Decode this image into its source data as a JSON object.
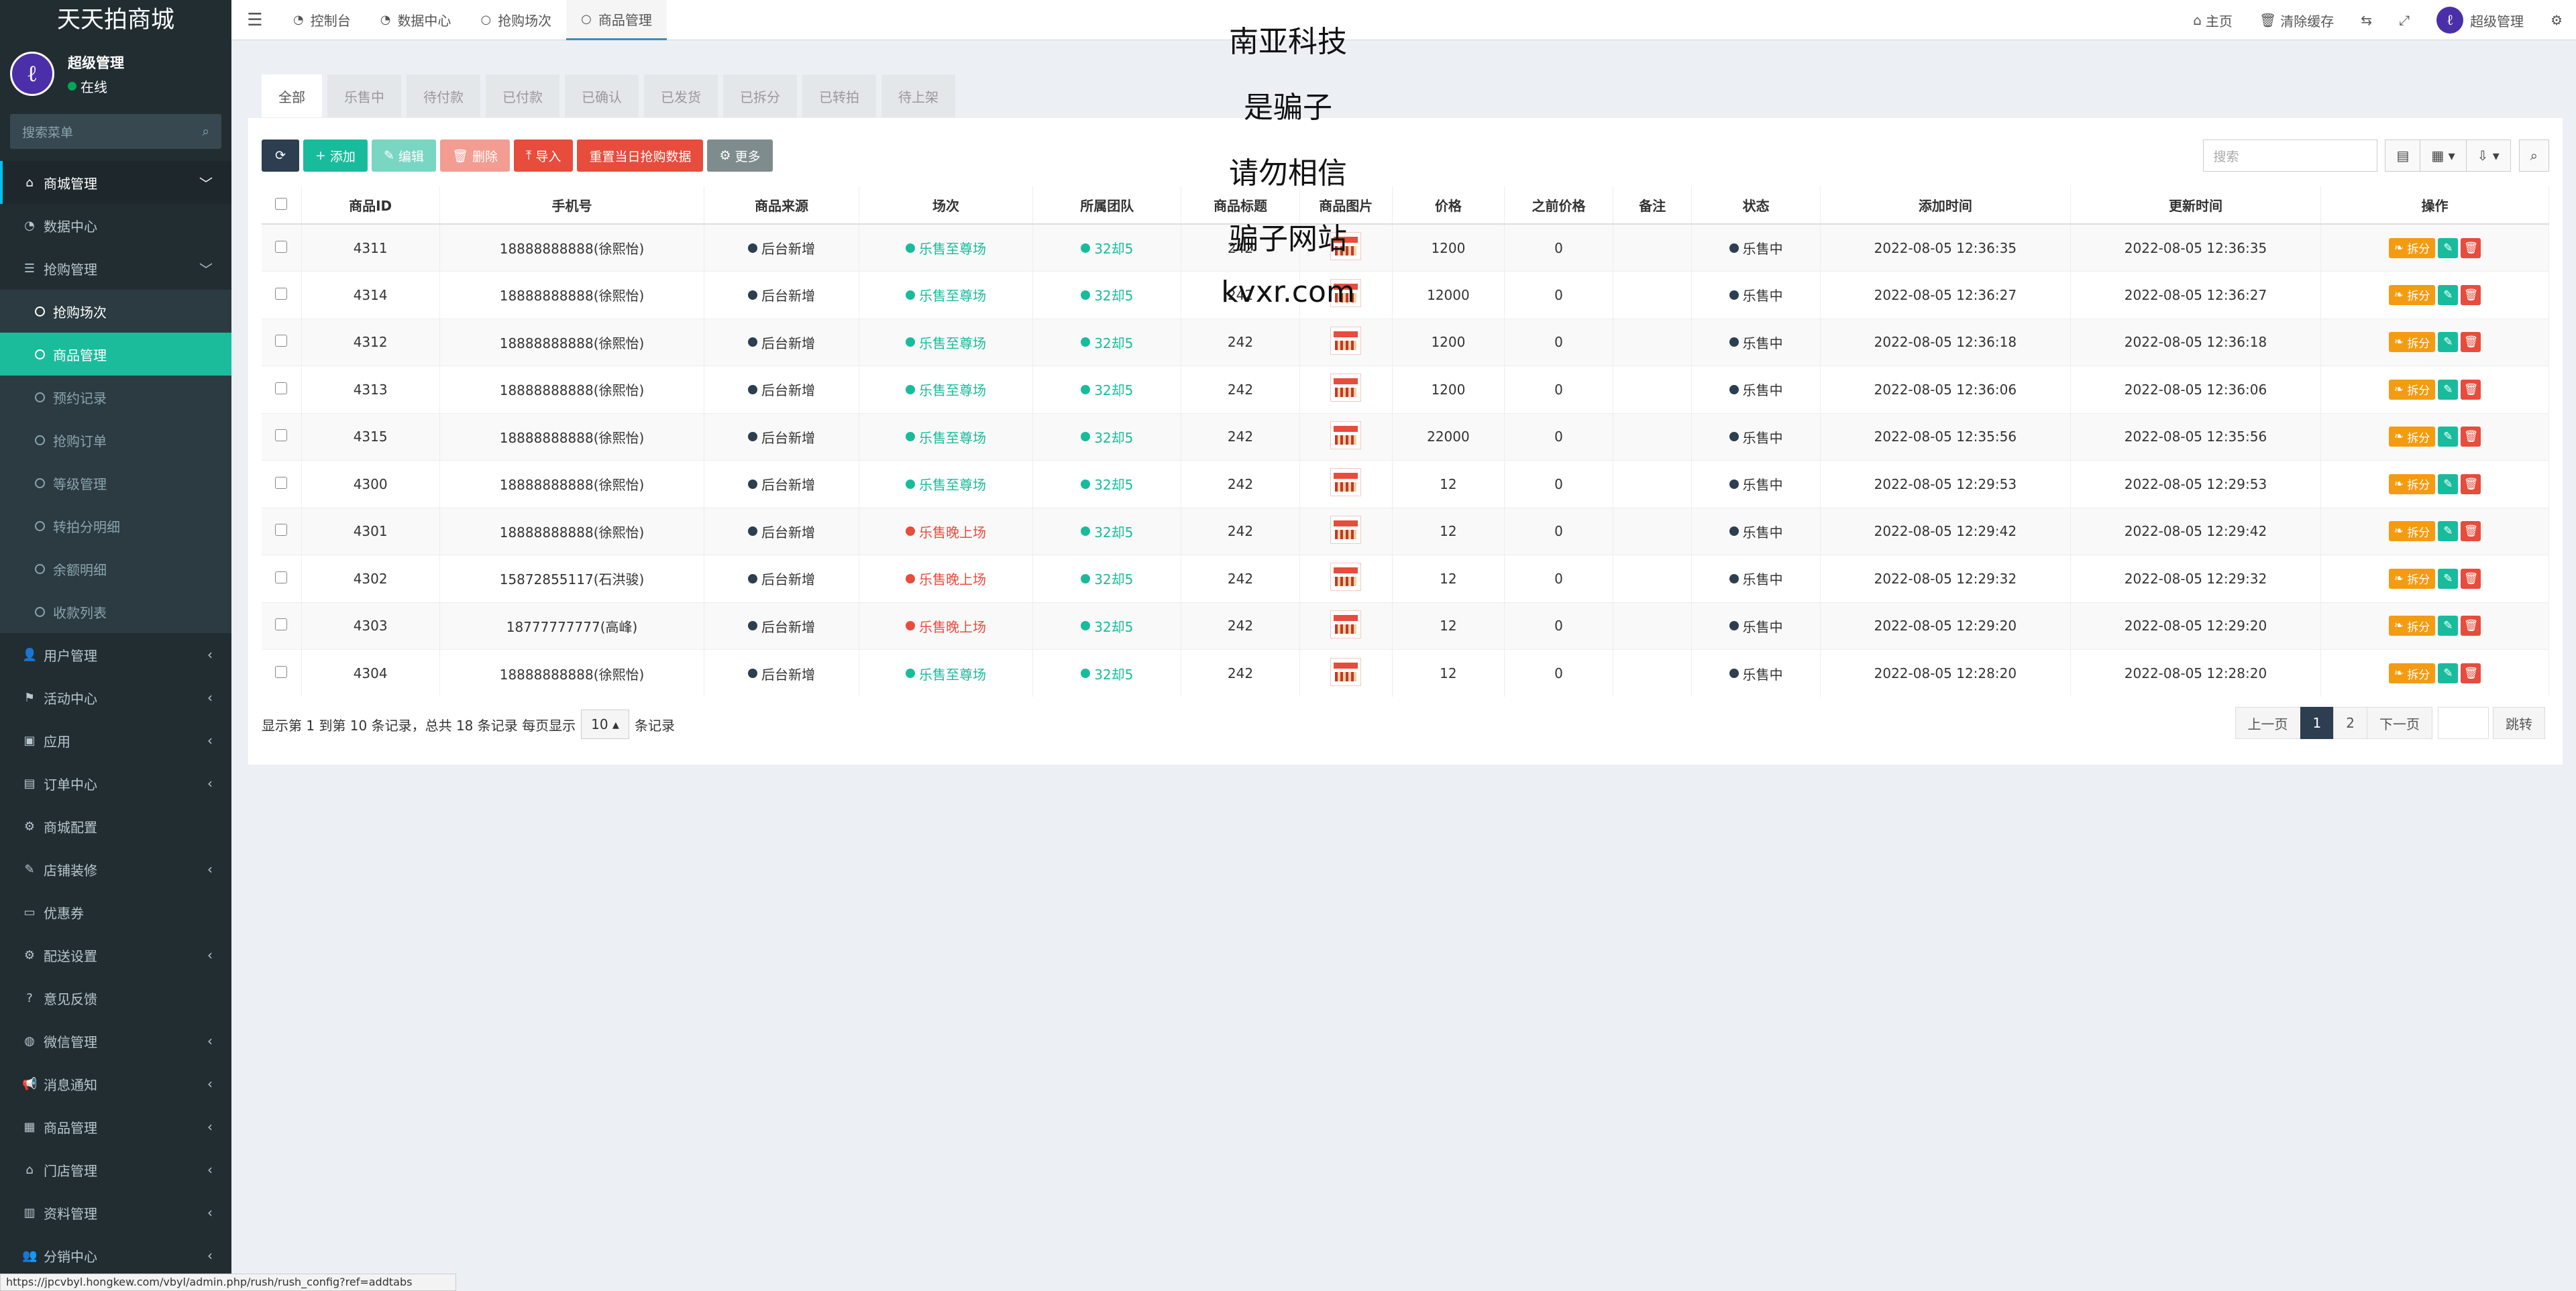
{
  "app": {
    "title": "天天拍商城"
  },
  "user": {
    "name": "超级管理",
    "status": "在线"
  },
  "sidebar": {
    "search_placeholder": "搜索菜单",
    "items": [
      {
        "label": "商城管理",
        "icon": "home-icon",
        "arrow": "﹀",
        "active": true
      },
      {
        "label": "数据中心",
        "icon": "dashboard-icon"
      },
      {
        "label": "抢购管理",
        "icon": "list-icon",
        "arrow": "﹀"
      }
    ],
    "submenu": [
      {
        "label": "抢购场次",
        "hot": true
      },
      {
        "label": "商品管理",
        "current": true
      },
      {
        "label": "预约记录"
      },
      {
        "label": "抢购订单"
      },
      {
        "label": "等级管理"
      },
      {
        "label": "转拍分明细"
      },
      {
        "label": "余额明细"
      },
      {
        "label": "收款列表"
      }
    ],
    "items_after": [
      {
        "label": "用户管理",
        "icon": "user-icon",
        "arrow": "‹"
      },
      {
        "label": "活动中心",
        "icon": "flag-icon",
        "arrow": "‹"
      },
      {
        "label": "应用",
        "icon": "app-icon",
        "arrow": "‹"
      },
      {
        "label": "订单中心",
        "icon": "file-icon",
        "arrow": "‹"
      },
      {
        "label": "商城配置",
        "icon": "gear-icon"
      },
      {
        "label": "店铺装修",
        "icon": "brush-icon",
        "arrow": "‹"
      },
      {
        "label": "优惠券",
        "icon": "ticket-icon"
      },
      {
        "label": "配送设置",
        "icon": "cogs-icon",
        "arrow": "‹"
      },
      {
        "label": "意见反馈",
        "icon": "question-icon"
      },
      {
        "label": "微信管理",
        "icon": "wechat-icon",
        "arrow": "‹"
      },
      {
        "label": "消息通知",
        "icon": "bullhorn-icon",
        "arrow": "‹"
      },
      {
        "label": "商品管理",
        "icon": "box-icon",
        "arrow": "‹"
      },
      {
        "label": "门店管理",
        "icon": "bank-icon",
        "arrow": "‹"
      },
      {
        "label": "资料管理",
        "icon": "book-icon",
        "arrow": "‹"
      },
      {
        "label": "分销中心",
        "icon": "users-icon",
        "arrow": "‹"
      }
    ]
  },
  "topbar": {
    "tabs": [
      {
        "label": "控制台",
        "icon": "dashboard-icon"
      },
      {
        "label": "数据中心",
        "icon": "dashboard-icon"
      },
      {
        "label": "抢购场次",
        "icon": "circle-icon"
      },
      {
        "label": "商品管理",
        "icon": "circle-icon",
        "active": true
      }
    ],
    "right": {
      "home": "主页",
      "clear_cache": "清除缓存",
      "admin": "超级管理"
    }
  },
  "watermark": [
    "南亚科技",
    "是骗子",
    "请勿相信",
    "骗子网站",
    "kvxr.com"
  ],
  "status_tabs": [
    "全部",
    "乐售中",
    "待付款",
    "已付款",
    "已确认",
    "已发货",
    "已拆分",
    "已转拍",
    "待上架"
  ],
  "toolbar": {
    "add": "添加",
    "edit": "编辑",
    "delete": "删除",
    "import": "导入",
    "reset": "重置当日抢购数据",
    "more": "更多",
    "search_placeholder": "搜索"
  },
  "table": {
    "headers": [
      "商品ID",
      "手机号",
      "商品来源",
      "场次",
      "所属团队",
      "商品标题",
      "商品图片",
      "价格",
      "之前价格",
      "备注",
      "状态",
      "添加时间",
      "更新时间",
      "操作"
    ],
    "rows": [
      {
        "id": "4311",
        "phone": "18888888888(徐熙怡)",
        "source": "后台新增",
        "session": "乐售至尊场",
        "session_color": "green",
        "team": "32却5",
        "title": "242",
        "price": "1200",
        "prev": "0",
        "note": "",
        "status": "乐售中",
        "added": "2022-08-05 12:36:35",
        "updated": "2022-08-05 12:36:35"
      },
      {
        "id": "4314",
        "phone": "18888888888(徐熙怡)",
        "source": "后台新增",
        "session": "乐售至尊场",
        "session_color": "green",
        "team": "32却5",
        "title": "242",
        "price": "12000",
        "prev": "0",
        "note": "",
        "status": "乐售中",
        "added": "2022-08-05 12:36:27",
        "updated": "2022-08-05 12:36:27"
      },
      {
        "id": "4312",
        "phone": "18888888888(徐熙怡)",
        "source": "后台新增",
        "session": "乐售至尊场",
        "session_color": "green",
        "team": "32却5",
        "title": "242",
        "price": "1200",
        "prev": "0",
        "note": "",
        "status": "乐售中",
        "added": "2022-08-05 12:36:18",
        "updated": "2022-08-05 12:36:18"
      },
      {
        "id": "4313",
        "phone": "18888888888(徐熙怡)",
        "source": "后台新增",
        "session": "乐售至尊场",
        "session_color": "green",
        "team": "32却5",
        "title": "242",
        "price": "1200",
        "prev": "0",
        "note": "",
        "status": "乐售中",
        "added": "2022-08-05 12:36:06",
        "updated": "2022-08-05 12:36:06"
      },
      {
        "id": "4315",
        "phone": "18888888888(徐熙怡)",
        "source": "后台新增",
        "session": "乐售至尊场",
        "session_color": "green",
        "team": "32却5",
        "title": "242",
        "price": "22000",
        "prev": "0",
        "note": "",
        "status": "乐售中",
        "added": "2022-08-05 12:35:56",
        "updated": "2022-08-05 12:35:56"
      },
      {
        "id": "4300",
        "phone": "18888888888(徐熙怡)",
        "source": "后台新增",
        "session": "乐售至尊场",
        "session_color": "green",
        "team": "32却5",
        "title": "242",
        "price": "12",
        "prev": "0",
        "note": "",
        "status": "乐售中",
        "added": "2022-08-05 12:29:53",
        "updated": "2022-08-05 12:29:53"
      },
      {
        "id": "4301",
        "phone": "18888888888(徐熙怡)",
        "source": "后台新增",
        "session": "乐售晚上场",
        "session_color": "red",
        "team": "32却5",
        "title": "242",
        "price": "12",
        "prev": "0",
        "note": "",
        "status": "乐售中",
        "added": "2022-08-05 12:29:42",
        "updated": "2022-08-05 12:29:42"
      },
      {
        "id": "4302",
        "phone": "15872855117(石洪骏)",
        "source": "后台新增",
        "session": "乐售晚上场",
        "session_color": "red",
        "team": "32却5",
        "title": "242",
        "price": "12",
        "prev": "0",
        "note": "",
        "status": "乐售中",
        "added": "2022-08-05 12:29:32",
        "updated": "2022-08-05 12:29:32"
      },
      {
        "id": "4303",
        "phone": "18777777777(高峰)",
        "source": "后台新增",
        "session": "乐售晚上场",
        "session_color": "red",
        "team": "32却5",
        "title": "242",
        "price": "12",
        "prev": "0",
        "note": "",
        "status": "乐售中",
        "added": "2022-08-05 12:29:20",
        "updated": "2022-08-05 12:29:20"
      },
      {
        "id": "4304",
        "phone": "18888888888(徐熙怡)",
        "source": "后台新增",
        "session": "乐售至尊场",
        "session_color": "green",
        "team": "32却5",
        "title": "242",
        "price": "12",
        "prev": "0",
        "note": "",
        "status": "乐售中",
        "added": "2022-08-05 12:28:20",
        "updated": "2022-08-05 12:28:20"
      }
    ],
    "op_split": "拆分"
  },
  "footer": {
    "info_prefix": "显示第 1 到第 10 条记录，总共 18 条记录 每页显示",
    "page_size": "10",
    "info_suffix": "条记录",
    "prev": "上一页",
    "next": "下一页",
    "pages": [
      "1",
      "2"
    ],
    "go": "跳转"
  },
  "statusbar": "https://jpcvbyl.hongkew.com/vbyl/admin.php/rush/rush_config?ref=addtabs"
}
